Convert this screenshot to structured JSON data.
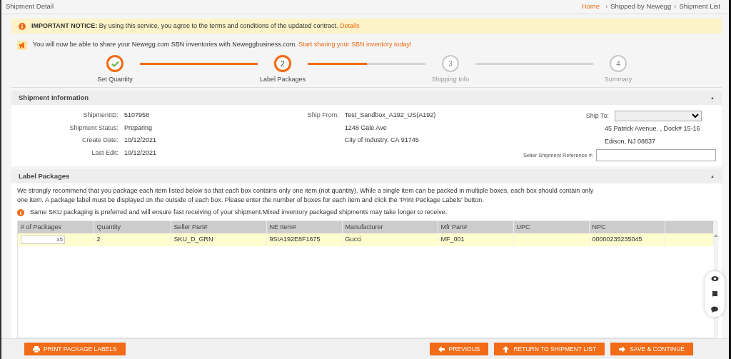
{
  "page_title": "Shipment Detail",
  "breadcrumb": [
    {
      "label": "Home",
      "link": true
    },
    {
      "separator": "›",
      "label": "Shipped by Newegg",
      "link": false
    },
    {
      "separator": "›",
      "label": "Shipment List",
      "link": false
    }
  ],
  "notice": {
    "label": "IMPORTANT NOTICE:",
    "text": "By using this service, you agree to the terms and conditions of the updated contract.",
    "link": "Details"
  },
  "announcement": {
    "text": "You will now be able to share your Newegg.com SBN inventories with Neweggbusiness.com.",
    "link": "Start sharing your SBN inventory today!"
  },
  "steps": [
    {
      "label": "Set Quantity",
      "completed": true,
      "selected": false
    },
    {
      "number": "2",
      "label": "Label Packages",
      "completed": false,
      "selected": true
    },
    {
      "number": "3",
      "label": "Shipping Info",
      "completed": false,
      "selected": false
    },
    {
      "number": "4",
      "label": "Summary",
      "completed": false,
      "selected": false
    }
  ],
  "shipment_information": {
    "title": "Shipment Information",
    "toggle": "▲",
    "fields": [
      {
        "label": "ShipmentID:",
        "value": "5107958"
      },
      {
        "label": "Shipment Status:",
        "value": "Preparing"
      },
      {
        "label": "Create Date:",
        "value": "10/12/2021"
      },
      {
        "label": "Last Edit:",
        "value": "10/12/2021"
      }
    ],
    "ship_from": {
      "label": "Ship From:",
      "lines": [
        "Test_Sandbox_A192_US(A192)",
        "1248 Gale Ave",
        "City of Industry, CA 91745"
      ]
    },
    "ship_to": {
      "label": "Ship To:",
      "lines": [
        "45 Patrick Avenue. , Dock# 15-16",
        "Edison, NJ 08837"
      ]
    },
    "reference": {
      "label": "Seller Shipment Reference #:"
    }
  },
  "label_packages": {
    "title": "Label Packages",
    "toggle": "▲",
    "description": "We strongly recommend that you package each item listed below so that each box contains only one item (not quantity). While a single item can be packed in multiple boxes, each box should contain only one item. A package label must be displayed on the outside of each box. Please enter the number of boxes for each item and click the 'Print Package Labels' button.",
    "hint": "Same SKU packaging is preferred and will ensure fast receiving of your shipment.Mixed inventory packaged shipments may take longer to receive.",
    "table": {
      "columns": [
        "# of Packages",
        "Quantity",
        "Seller Part#",
        "NE Item#",
        "Manufacturer",
        "Mfr Part#",
        "UPC",
        "NPC"
      ],
      "rows": [
        {
          "selected": true,
          "cells": [
            "35",
            "2",
            "SKU_D_GRN",
            "9SIA192E8F1675",
            "Gucci",
            "MF_001",
            "",
            "00000235235045"
          ]
        }
      ]
    }
  },
  "buttons": [
    {
      "label": "PRINT PACKAGE LABELS"
    },
    {
      "label": "PREVIOUS"
    },
    {
      "label": "RETURN TO SHIPMENT LIST"
    },
    {
      "label": "SAVE & CONTINUE"
    }
  ]
}
